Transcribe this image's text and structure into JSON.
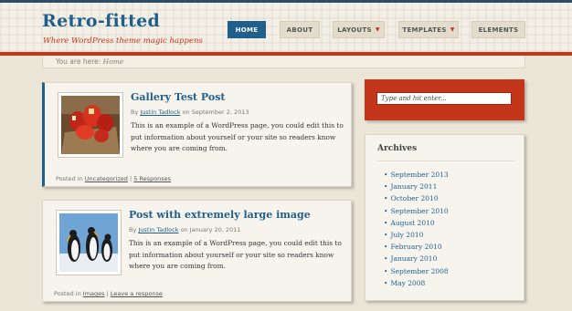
{
  "site": {
    "title": "Retro-fitted",
    "tagline": "Where WordPress theme magic happens"
  },
  "nav": [
    {
      "label": "HOME",
      "active": true,
      "dropdown": false
    },
    {
      "label": "ABOUT",
      "active": false,
      "dropdown": false
    },
    {
      "label": "LAYOUTS",
      "active": false,
      "dropdown": true
    },
    {
      "label": "TEMPLATES",
      "active": false,
      "dropdown": true
    },
    {
      "label": "ELEMENTS",
      "active": false,
      "dropdown": false
    }
  ],
  "breadcrumb": {
    "prefix": "You are here:",
    "current": "Home"
  },
  "posts": [
    {
      "title": "Gallery Test Post",
      "by": "By",
      "author": "Justin Tadlock",
      "date_prefix": "on",
      "date": "September 2, 2013",
      "excerpt": "This is an example of a WordPress page, you could edit this to put information about yourself or your site so readers know where you are coming from.",
      "footer_prefix": "Posted in",
      "category": "Uncategorized",
      "separator": "|",
      "comments": "5 Responses",
      "thumbnail": "red-gift-bags-photo"
    },
    {
      "title": "Post with extremely large image",
      "by": "By",
      "author": "Justin Tadlock",
      "date_prefix": "on",
      "date": "January 20, 2011",
      "excerpt": "This is an example of a WordPress page, you could edit this to put information about yourself or your site so readers know where you are coming from.",
      "footer_prefix": "Posted in",
      "category": "Images",
      "separator": "|",
      "comments": "Leave a response",
      "thumbnail": "penguins-photo"
    }
  ],
  "search": {
    "placeholder": "Type and hit enter..."
  },
  "archives": {
    "title": "Archives",
    "items": [
      "September 2013",
      "January 2011",
      "October 2010",
      "September 2010",
      "August 2010",
      "July 2010",
      "February 2010",
      "January 2010",
      "September 2008",
      "May 2008"
    ]
  },
  "colors": {
    "accent_blue": "#1f5f8b",
    "accent_red": "#c4361a",
    "background": "#ece6d9"
  }
}
